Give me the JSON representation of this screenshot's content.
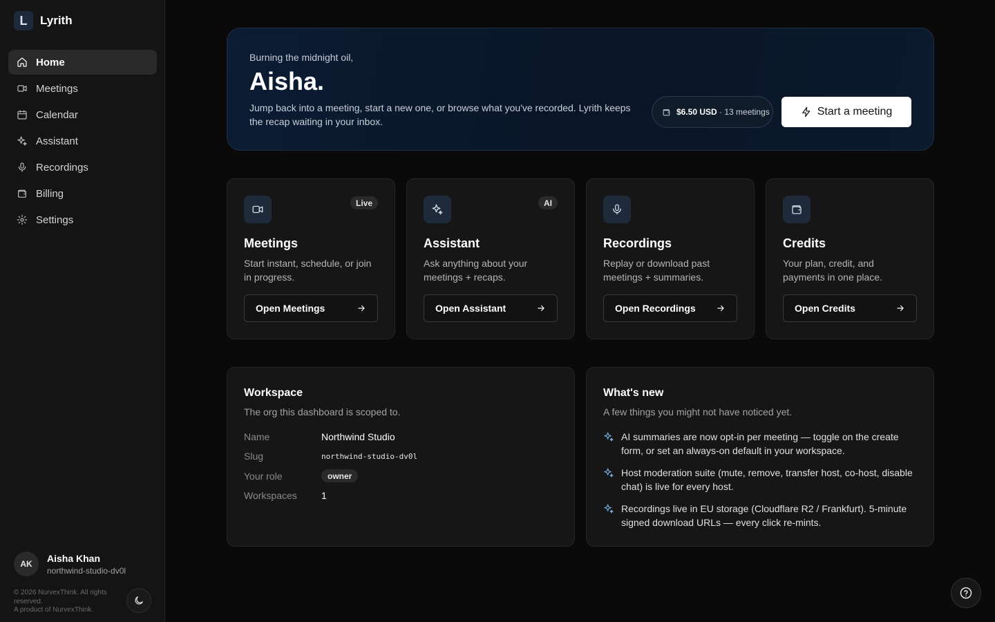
{
  "brand": {
    "name": "Lyrith",
    "logo_letter": "L"
  },
  "nav": [
    {
      "label": "Home",
      "icon": "home-icon",
      "active": true
    },
    {
      "label": "Meetings",
      "icon": "video-icon"
    },
    {
      "label": "Calendar",
      "icon": "calendar-icon"
    },
    {
      "label": "Assistant",
      "icon": "sparkles-icon"
    },
    {
      "label": "Recordings",
      "icon": "mic-icon"
    },
    {
      "label": "Billing",
      "icon": "wallet-icon"
    },
    {
      "label": "Settings",
      "icon": "gear-icon"
    }
  ],
  "user": {
    "initials": "AK",
    "name": "Aisha Khan",
    "slug": "northwind-studio-dv0l"
  },
  "footer": {
    "copyright": "© 2026 NurvexThink. All rights reserved.",
    "product": "A product of NurvexThink."
  },
  "hero": {
    "greeting": "Burning the midnight oil,",
    "name": "Aisha.",
    "description": "Jump back into a meeting, start a new one, or browse what you've recorded. Lyrith keeps the recap waiting in your inbox.",
    "credit_amount": "$6.50 USD",
    "credit_meetings": "· 13 meetings",
    "start_button": "Start a meeting"
  },
  "cards": [
    {
      "title": "Meetings",
      "badge": "Live",
      "description": "Start instant, schedule, or join in progress.",
      "button": "Open Meetings",
      "icon": "video-icon"
    },
    {
      "title": "Assistant",
      "badge": "AI",
      "description": "Ask anything about your meetings + recaps.",
      "button": "Open Assistant",
      "icon": "sparkles-icon"
    },
    {
      "title": "Recordings",
      "badge": "",
      "description": "Replay or download past meetings + summaries.",
      "button": "Open Recordings",
      "icon": "mic-icon"
    },
    {
      "title": "Credits",
      "badge": "",
      "description": "Your plan, credit, and payments in one place.",
      "button": "Open Credits",
      "icon": "wallet-icon"
    }
  ],
  "workspace": {
    "title": "Workspace",
    "subtitle": "The org this dashboard is scoped to.",
    "name_label": "Name",
    "name_value": "Northwind Studio",
    "slug_label": "Slug",
    "slug_value": "northwind-studio-dv0l",
    "role_label": "Your role",
    "role_value": "owner",
    "count_label": "Workspaces",
    "count_value": "1"
  },
  "whats_new": {
    "title": "What's new",
    "subtitle": "A few things you might not have noticed yet.",
    "items": [
      "AI summaries are now opt-in per meeting — toggle on the create form, or set an always-on default in your workspace.",
      "Host moderation suite (mute, remove, transfer host, co-host, disable chat) is live for every host.",
      "Recordings live in EU storage (Cloudflare R2 / Frankfurt). 5-minute signed download URLs — every click re-mints."
    ]
  }
}
